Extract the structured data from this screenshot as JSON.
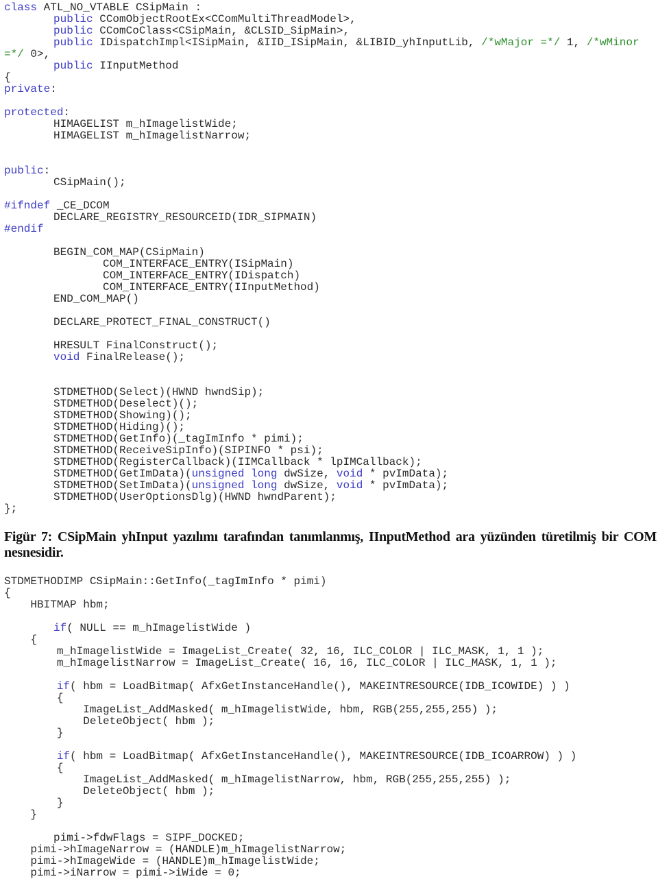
{
  "colors": {
    "keyword": "#3b3bc4",
    "comment": "#2f8f2f",
    "text": "#2a2a2a"
  },
  "code_listing_1": [
    "class ATL_NO_VTABLE CSipMain :",
    "\tpublic CComObjectRootEx<CComMultiThreadModel>,",
    "\tpublic CComCoClass<CSipMain, &CLSID_SipMain>,",
    "\tpublic IDispatchImpl<ISipMain, &IID_ISipMain, &LIBID_yhInputLib, /*wMajor =*/ 1, /*wMinor",
    "=*/ 0>,",
    "\tpublic IInputMethod",
    "{",
    "private:",
    "",
    "protected:",
    "\tHIMAGELIST m_hImagelistWide;",
    "\tHIMAGELIST m_hImagelistNarrow;",
    "",
    "",
    "public:",
    "\tCSipMain();",
    "",
    "#ifndef _CE_DCOM",
    "\tDECLARE_REGISTRY_RESOURCEID(IDR_SIPMAIN)",
    "#endif",
    "",
    "\tBEGIN_COM_MAP(CSipMain)",
    "\t\tCOM_INTERFACE_ENTRY(ISipMain)",
    "\t\tCOM_INTERFACE_ENTRY(IDispatch)",
    "\t\tCOM_INTERFACE_ENTRY(IInputMethod)",
    "\tEND_COM_MAP()",
    "",
    "\tDECLARE_PROTECT_FINAL_CONSTRUCT()",
    "",
    "\tHRESULT FinalConstruct();",
    "\tvoid FinalRelease();",
    "",
    "",
    "\tSTDMETHOD(Select)(HWND hwndSip);",
    "\tSTDMETHOD(Deselect)();",
    "\tSTDMETHOD(Showing)();",
    "\tSTDMETHOD(Hiding)();",
    "\tSTDMETHOD(GetInfo)(_tagImInfo * pimi);",
    "\tSTDMETHOD(ReceiveSipInfo)(SIPINFO * psi);",
    "\tSTDMETHOD(RegisterCallback)(IIMCallback * lpIMCallback);",
    "\tSTDMETHOD(GetImData)(unsigned long dwSize, void * pvImData);",
    "\tSTDMETHOD(SetImData)(unsigned long dwSize, void * pvImData);",
    "\tSTDMETHOD(UserOptionsDlg)(HWND hwndParent);",
    "};"
  ],
  "caption": "Figür 7:  CSipMain yhInput yazılımı tarafından tanımlanmış, IInputMethod ara yüzünden türetilmiş bir COM nesnesidir.",
  "code_listing_2": [
    "STDMETHODIMP CSipMain::GetInfo(_tagImInfo * pimi)",
    "{",
    "    HBITMAP hbm;",
    "",
    "\tif( NULL == m_hImagelistWide )",
    "    {",
    "        m_hImagelistWide = ImageList_Create( 32, 16, ILC_COLOR | ILC_MASK, 1, 1 );",
    "        m_hImagelistNarrow = ImageList_Create( 16, 16, ILC_COLOR | ILC_MASK, 1, 1 );",
    "",
    "        if( hbm = LoadBitmap( AfxGetInstanceHandle(), MAKEINTRESOURCE(IDB_ICOWIDE) ) )",
    "        {",
    "            ImageList_AddMasked( m_hImagelistWide, hbm, RGB(255,255,255) );",
    "            DeleteObject( hbm );",
    "        }",
    "",
    "        if( hbm = LoadBitmap( AfxGetInstanceHandle(), MAKEINTRESOURCE(IDB_ICOARROW) ) )",
    "        {",
    "            ImageList_AddMasked( m_hImagelistNarrow, hbm, RGB(255,255,255) );",
    "            DeleteObject( hbm );",
    "        }",
    "    }",
    "",
    "\tpimi->fdwFlags = SIPF_DOCKED;",
    "    pimi->hImageNarrow = (HANDLE)m_hImagelistNarrow;",
    "    pimi->hImageWide = (HANDLE)m_hImagelistWide;",
    "    pimi->iNarrow = pimi->iWide = 0;"
  ]
}
